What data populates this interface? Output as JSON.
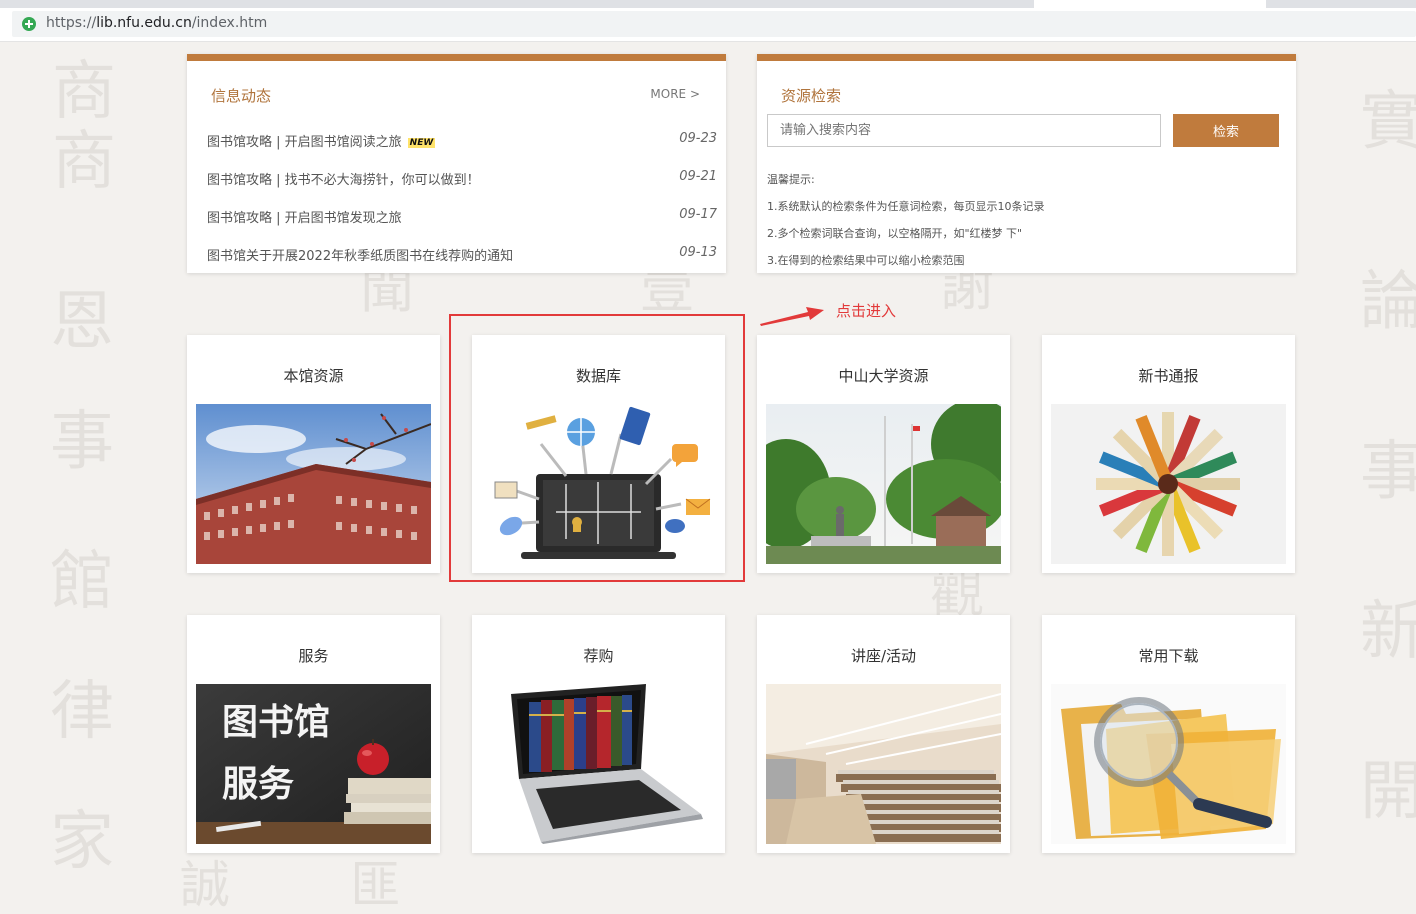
{
  "browser": {
    "url_scheme": "https://",
    "url_host": "lib.nfu.edu.cn",
    "url_path": "/index.htm"
  },
  "news": {
    "title": "信息动态",
    "more": "MORE >",
    "items": [
      {
        "title": "图书馆攻略 | 开启图书馆阅读之旅",
        "badge": "NEW",
        "date": "09-23"
      },
      {
        "title": "图书馆攻略 | 找书不必大海捞针，你可以做到！",
        "date": "09-21"
      },
      {
        "title": "图书馆攻略 | 开启图书馆发现之旅",
        "date": "09-17"
      },
      {
        "title": "图书馆关于开展2022年秋季纸质图书在线荐购的通知",
        "date": "09-13"
      }
    ]
  },
  "search": {
    "title": "资源检索",
    "placeholder": "请输入搜索内容",
    "button": "检索",
    "tips_title": "温馨提示:",
    "tips": [
      "1.系统默认的检索条件为任意词检索，每页显示10条记录",
      "2.多个检索词联合查询，以空格隔开，如\"红楼梦 下\"",
      "3.在得到的检索结果中可以缩小检索范围"
    ]
  },
  "annotation": {
    "text": "点击进入",
    "color": "#e23a3a"
  },
  "cards": [
    {
      "title": "本馆资源",
      "image": "library-building-photo"
    },
    {
      "title": "数据库",
      "image": "database-illustration"
    },
    {
      "title": "中山大学资源",
      "image": "campus-photo"
    },
    {
      "title": "新书通报",
      "image": "fanned-books-photo"
    },
    {
      "title": "服务",
      "image": "library-service-board",
      "image_text": [
        "图书馆",
        "服务"
      ]
    },
    {
      "title": "荐购",
      "image": "laptop-books-photo"
    },
    {
      "title": "讲座/活动",
      "image": "lecture-hall-photo"
    },
    {
      "title": "常用下载",
      "image": "folders-magnifier-photo"
    }
  ],
  "colors": {
    "accent": "#c07b3d",
    "background": "#f3f1ee"
  }
}
